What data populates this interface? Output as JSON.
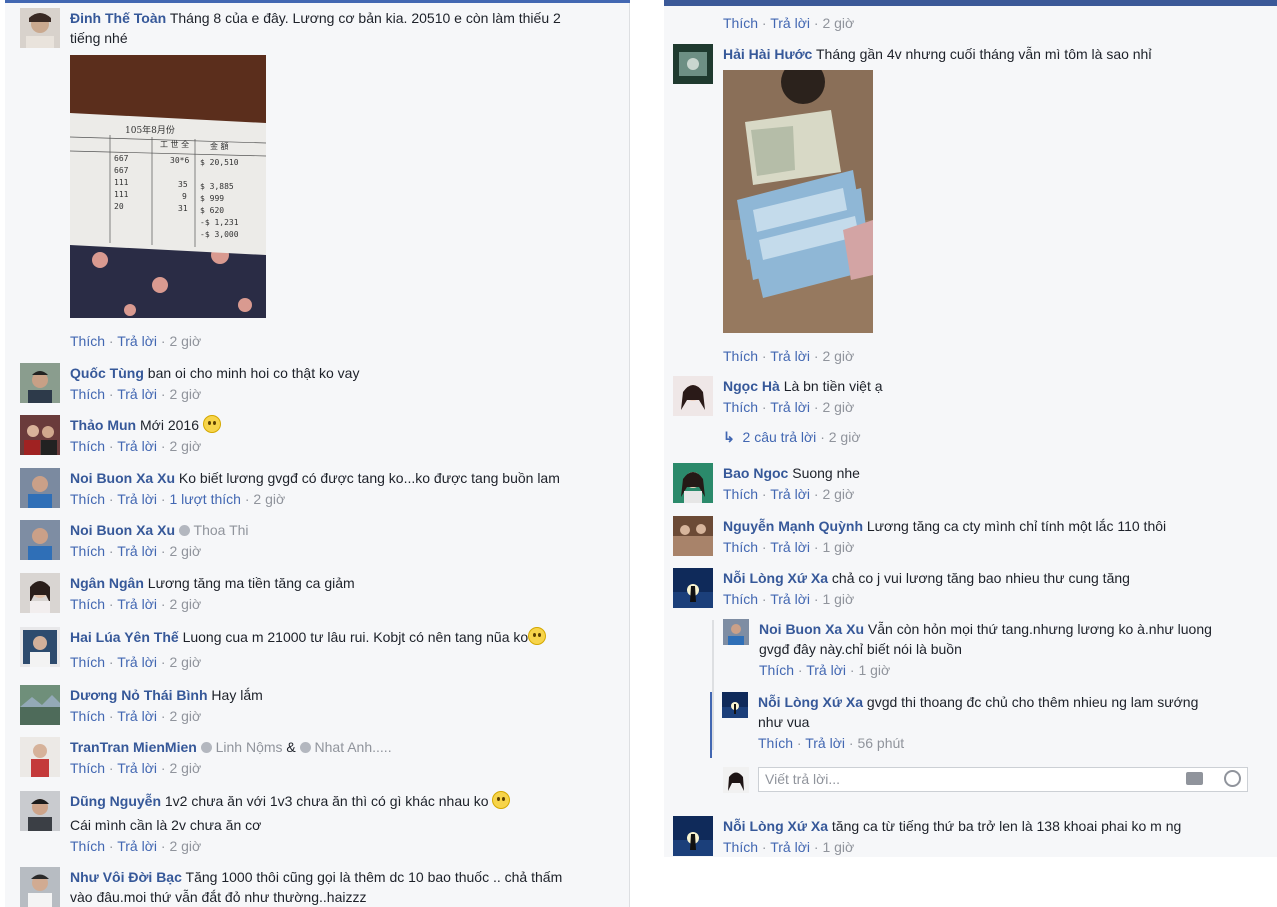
{
  "actions": {
    "like": "Thích",
    "reply": "Trả lời",
    "sep": "·"
  },
  "left": [
    {
      "author": "Đinh Thế Toàn",
      "text": "Tháng 8 của e đây. Lương cơ bản kia. 20510 e còn làm thiếu 2",
      "text2": "tiếng nhé",
      "time": "2 giờ"
    },
    {
      "author": "Quốc Tùng",
      "text": "ban oi cho minh hoi co thật ko vay",
      "time": "2 giờ"
    },
    {
      "author": "Thảo Mun",
      "text": "Mới 2016",
      "time": "2 giờ"
    },
    {
      "author": "Noi Buon Xa Xu",
      "text": "Ko biết lương gvgđ có được tang ko...ko được tang buồn lam",
      "likes": "1 lượt thích",
      "time": "2 giờ"
    },
    {
      "author": "Noi Buon Xa Xu",
      "tag": "Thoa Thi",
      "time": "2 giờ"
    },
    {
      "author": "Ngân Ngân",
      "text": "Lương tăng ma tiền tăng ca giảm",
      "time": "2 giờ"
    },
    {
      "author": "Hai Lúa Yên Thế",
      "text": "Luong cua m 21000 tư lâu rui. Kobjt có nên tang nũa ko",
      "time": "2 giờ"
    },
    {
      "author": "Dương Nỏ Thái Bình",
      "text": "Hay lắm",
      "time": "2 giờ"
    },
    {
      "author": "TranTran MienMien",
      "tag": "Linh Nộms",
      "amp": "&",
      "tag2": "Nhat Anh.....",
      "time": "2 giờ"
    },
    {
      "author": "Dũng Nguyễn",
      "text": "1v2 chưa ăn với 1v3 chưa ăn thì có gì khác nhau ko",
      "text2": "Cái mình cần là 2v chưa ăn cơ",
      "time": "2 giờ"
    },
    {
      "author": "Như Vôi Đời Bạc",
      "text": "Tăng 1000 thôi cũng gọi là thêm dc 10 bao thuốc .. chả thấm",
      "text2": "vào đâu.moi thứ vẫn đắt đỏ như thường..haizzz"
    }
  ],
  "receipt": {
    "title": "105年8月份",
    "headers": [
      "工 世 全",
      "金 額"
    ],
    "rows": [
      [
        "667",
        "30*6",
        "$ 20,510"
      ],
      [
        "667",
        "",
        ""
      ],
      [
        "111",
        "35",
        "$ 3,885"
      ],
      [
        "111",
        "9",
        "$ 999"
      ],
      [
        "20",
        "31",
        "$ 620"
      ],
      [
        "",
        "",
        "-$ 1,231"
      ],
      [
        "",
        "",
        "-$ 3,000"
      ]
    ]
  },
  "right": {
    "top_actions_time": "2 giờ",
    "comments": [
      {
        "author": "Hải Hài Hước",
        "text": "Tháng gần 4v nhưng cuối tháng vẫn mì tôm là sao nhỉ",
        "time": "2 giờ"
      },
      {
        "author": "Ngọc Hà",
        "text": "Là bn tiền việt ạ",
        "time": "2 giờ",
        "replies": "2 câu trả lời",
        "replies_time": "2 giờ"
      },
      {
        "author": "Bao Ngoc",
        "text": "Suong nhe",
        "time": "2 giờ"
      },
      {
        "author": "Nguyễn Mạnh Quỳnh",
        "text": "Lương tăng ca cty mình chỉ tính một lắc 110 thôi",
        "time": "1 giờ"
      },
      {
        "author": "Nỗi Lòng Xứ Xa",
        "text": "chả co j vui lương tăng bao nhieu thư cung tăng",
        "time": "1 giờ"
      },
      {
        "author": "Nỗi Lòng Xứ Xa",
        "text": "tăng ca từ tiếng thứ ba trở len là 138 khoai phai ko m ng",
        "time": "1 giờ"
      }
    ],
    "replies": [
      {
        "author": "Noi Buon Xa Xu",
        "text": "Vẫn còn hỏn mọi thứ tang.nhưng lương ko à.như luong",
        "text2": "gvgđ đây này.chỉ biết nói là buồn",
        "time": "1 giờ"
      },
      {
        "author": "Nỗi Lòng Xứ Xa",
        "text": "gvgd thi thoang đc chủ cho thêm nhieu ng lam sướng",
        "text2": "như vua",
        "time": "56 phút"
      }
    ],
    "reply_placeholder": "Viết trả lời..."
  }
}
